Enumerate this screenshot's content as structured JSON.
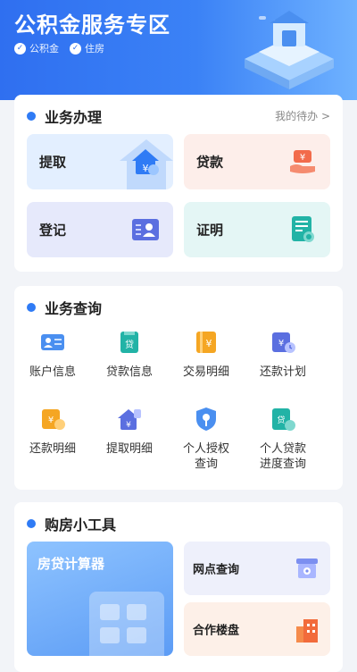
{
  "header": {
    "title": "公积金服务专区",
    "tags": [
      "公积金",
      "住房"
    ]
  },
  "business": {
    "title": "业务办理",
    "more": "我的待办 >",
    "tiles": [
      {
        "label": "提取",
        "icon": "house-yuan-icon"
      },
      {
        "label": "贷款",
        "icon": "hand-yuan-icon"
      },
      {
        "label": "登记",
        "icon": "id-card-icon"
      },
      {
        "label": "证明",
        "icon": "certificate-icon"
      }
    ]
  },
  "query": {
    "title": "业务查询",
    "items": [
      {
        "label": "账户信息",
        "icon": "account-card-icon"
      },
      {
        "label": "贷款信息",
        "icon": "loan-doc-icon"
      },
      {
        "label": "交易明细",
        "icon": "ledger-yuan-icon"
      },
      {
        "label": "还款计划",
        "icon": "repay-plan-icon"
      },
      {
        "label": "还款明细",
        "icon": "repay-detail-icon"
      },
      {
        "label": "提取明细",
        "icon": "withdraw-detail-icon"
      },
      {
        "label": "个人授权\n查询",
        "icon": "shield-key-icon"
      },
      {
        "label": "个人贷款\n进度查询",
        "icon": "loan-progress-icon"
      }
    ]
  },
  "tools": {
    "title": "购房小工具",
    "calculator": "房贷计算器",
    "items": [
      {
        "label": "网点查询",
        "icon": "branch-store-icon"
      },
      {
        "label": "合作楼盘",
        "icon": "building-icon"
      }
    ]
  }
}
